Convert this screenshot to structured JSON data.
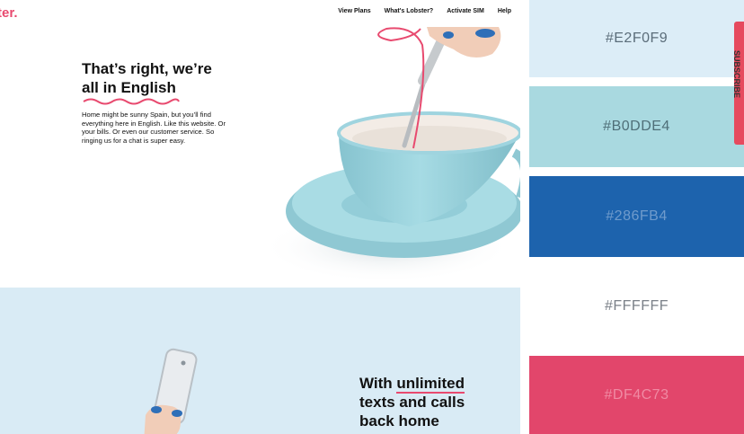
{
  "site": {
    "logo": "ter.",
    "nav": [
      "View Plans",
      "What's Lobster?",
      "Activate SIM",
      "Help"
    ],
    "hero": {
      "headline_line1": "That’s right, we’re",
      "headline_line2": "all in English",
      "paragraph": "Home might be sunny Spain, but you’ll find everything here in English. Like this website. Or your bills. Or even our customer service. So ringing us for a chat is super easy."
    },
    "band": {
      "headline_word1": "With",
      "headline_underlined": "unlimited",
      "headline_line2": "texts and calls",
      "headline_line3": "back home"
    }
  },
  "palette": {
    "swatches": [
      {
        "hex": "#E2F0F9",
        "color": "#dcedf7",
        "text_color": "#5b6d7a"
      },
      {
        "hex": "#B0DDE4",
        "color": "#a9d9e0",
        "text_color": "#4f6f78"
      },
      {
        "hex": "#286FB4",
        "color": "#1d63ad",
        "text_color": "#6f9bcc"
      },
      {
        "hex": "#FFFFFF",
        "color": "#ffffff",
        "text_color": "#7a8088"
      },
      {
        "hex": "#DF4C73",
        "color": "#e2466b",
        "text_color": "#f08aa3"
      }
    ],
    "subscribe_label": "SUBSCRIBE"
  },
  "colors": {
    "brand_pink": "#e84a6f",
    "light_blue_band": "#d9ebf5",
    "cup_blue": "#9fd4df"
  }
}
